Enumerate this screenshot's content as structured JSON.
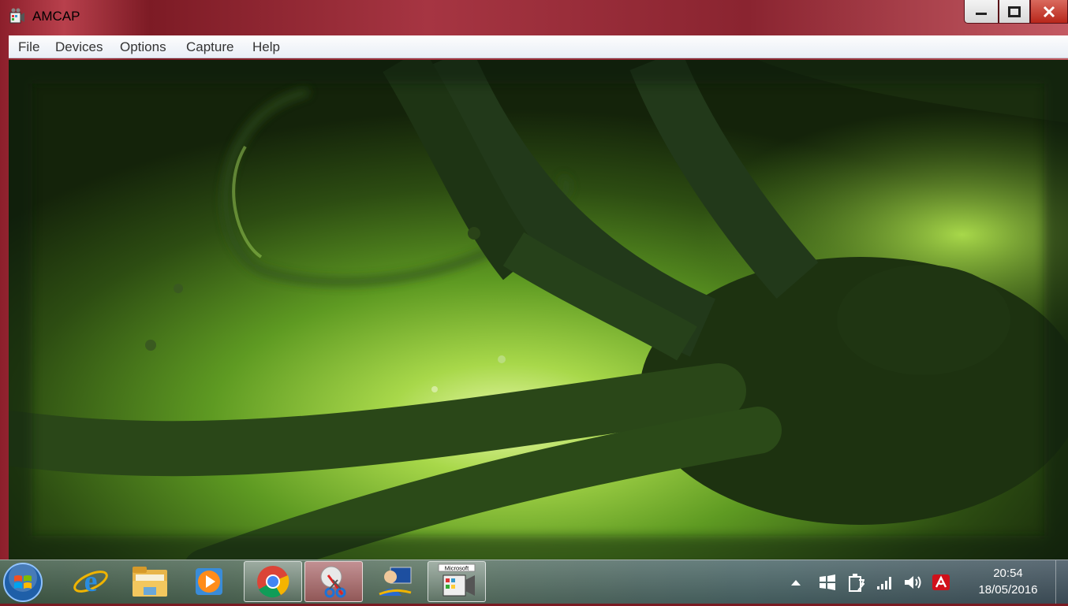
{
  "window": {
    "title": "AMCAP",
    "menus": [
      "File",
      "Devices",
      "Options",
      "Capture",
      "Help"
    ]
  },
  "taskbar": {
    "pinned": [
      {
        "name": "internet-explorer-icon"
      },
      {
        "name": "file-explorer-icon"
      },
      {
        "name": "media-player-icon"
      },
      {
        "name": "chrome-icon"
      },
      {
        "name": "snipping-tool-icon"
      },
      {
        "name": "user-app-icon"
      },
      {
        "name": "amcap-camera-icon",
        "badge": "Microsoft"
      }
    ],
    "tray": [
      "show-hidden-icons",
      "windows-flag-icon",
      "power-icon",
      "network-signal-icon",
      "volume-icon",
      "antivirus-icon"
    ],
    "clock": {
      "time": "20:54",
      "date": "18/05/2016"
    }
  },
  "colors": {
    "title_accent": "#8c1f2b",
    "close_button": "#c7372a",
    "preview_green": "#6fae2a"
  }
}
